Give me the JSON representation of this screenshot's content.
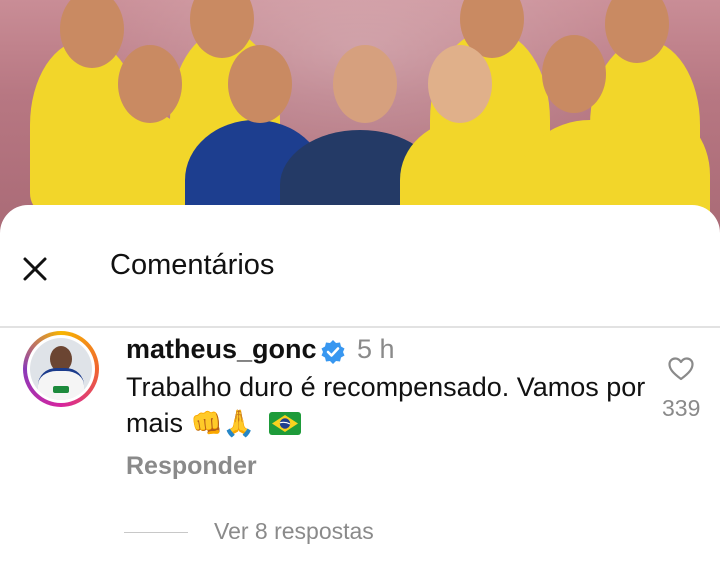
{
  "header": {
    "title": "Comentários",
    "close_icon": "close-icon"
  },
  "comment": {
    "username": "matheus_gonc",
    "verified_icon": "verified-badge-icon",
    "time": "5 h",
    "text": "Trabalho duro é recompensado. Vamos por mais",
    "emojis": "👊🙏",
    "flag_icon": "brazil-flag-icon",
    "reply_label": "Responder",
    "like_icon": "heart-icon",
    "like_count": "339",
    "view_replies_label": "Ver 8 respostas"
  },
  "colors": {
    "text_primary": "#111111",
    "text_secondary": "#8a8a8a",
    "verified_blue": "#3897f0",
    "divider": "#e2e2e2"
  }
}
